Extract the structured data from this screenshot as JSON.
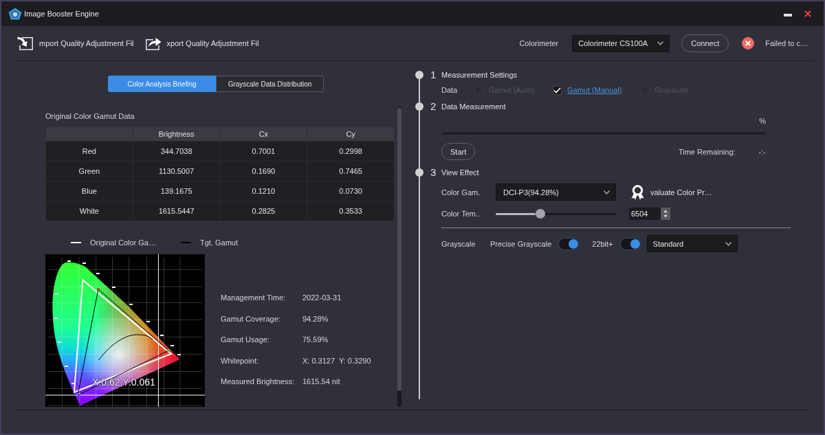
{
  "window": {
    "title": "Image Booster Engine"
  },
  "toolbar": {
    "file_actions": [
      {
        "kind": "import",
        "label": "mport Quality Adjustment Fil"
      },
      {
        "kind": "export",
        "label": "xport Quality Adjustment Fil"
      }
    ],
    "colorimeter": {
      "label": "Colorimeter",
      "device": "Colorimeter CS100A",
      "connect_button": "Connect",
      "status": {
        "connected": false,
        "text": "Failed to c…"
      }
    }
  },
  "tabs": [
    {
      "label": "Color Analysis Briefing",
      "selected": true
    },
    {
      "label": "Grayscale Data Distribution",
      "selected": false
    }
  ],
  "gamut_table": {
    "title": "Original Color Gamut Data",
    "columns": [
      "Brightness",
      "Cx",
      "Cy"
    ],
    "rows": [
      {
        "label": "Red",
        "cells": [
          "344.7038",
          "0.7001",
          "0.2998"
        ]
      },
      {
        "label": "Green",
        "cells": [
          "1130.5007",
          "0.1690",
          "0.7465"
        ]
      },
      {
        "label": "Blue",
        "cells": [
          "139.1675",
          "0.1210",
          "0.0730"
        ]
      },
      {
        "label": "White",
        "cells": [
          "1615.5447",
          "0.2825",
          "0.3533"
        ]
      }
    ]
  },
  "legend": [
    {
      "label": "Original Color Ga…",
      "color": "#ffffff"
    },
    {
      "label": "Tgt. Gamut",
      "color": "#000000"
    }
  ],
  "chromaticity_diagram": {
    "readout": "X:0.62,Y:0.061"
  },
  "summary": [
    {
      "label": "Management Time:",
      "value": "2022-03-31"
    },
    {
      "label": "Gamut Coverage:",
      "value": "94.28%"
    },
    {
      "label": "Gamut Usage:",
      "value": "75.59%"
    },
    {
      "label": "Whitepoint:",
      "value": "X: 0.3127  Y: 0.3290"
    },
    {
      "label": "Measured Brightness:",
      "value": "1615.54 nit"
    }
  ],
  "measurement_settings": {
    "number": "1",
    "title": "Measurement Settings",
    "data_label": "Data",
    "options": [
      {
        "label": "Gamut (Auto)",
        "checked": false,
        "disabled": true
      },
      {
        "label": "Gamut (Manual)",
        "checked": true,
        "disabled": false
      },
      {
        "label": "Grayscale",
        "checked": false,
        "disabled": true
      }
    ]
  },
  "data_measurement": {
    "number": "2",
    "title": "Data Measurement",
    "percent_text": "%",
    "level": 0,
    "start_button": "Start",
    "time_label": "Time Remaining:",
    "time_value": "-:-"
  },
  "view_effect": {
    "number": "3",
    "title": "View Effect",
    "color_gamut": {
      "label": "Color Gam.",
      "value": "DCI-P3(94.28%)"
    },
    "evaluate_button": "valuate Color Pr…",
    "color_temperature": {
      "label": "Color Tem..",
      "level": 0.37,
      "value": "6504"
    },
    "grayscale": {
      "label": "Grayscale",
      "toggles": [
        {
          "label": "Precise Grayscale",
          "on": true
        },
        {
          "label": "22bit+",
          "on": true
        }
      ],
      "mode": "Standard"
    }
  }
}
